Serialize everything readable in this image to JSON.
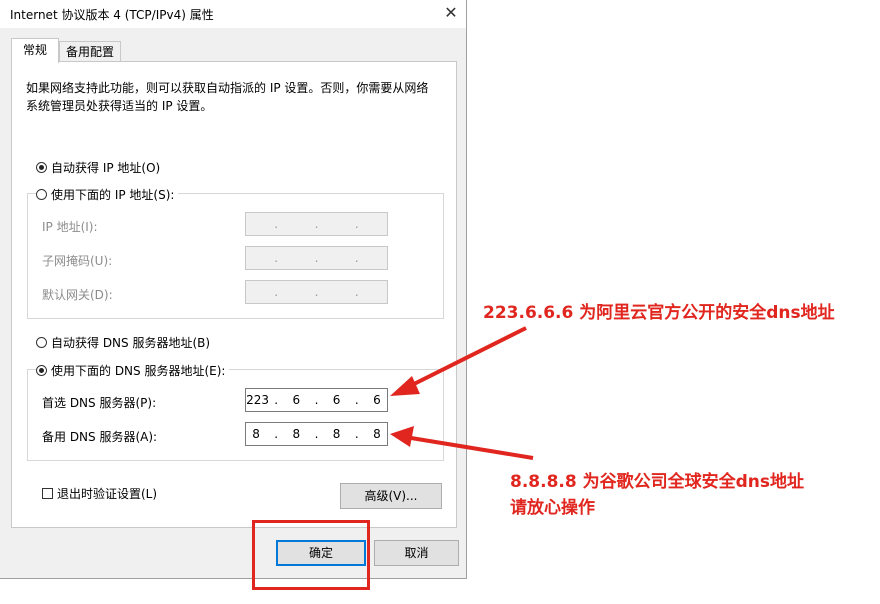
{
  "window": {
    "title": "Internet 协议版本 4 (TCP/IPv4) 属性",
    "close_glyph": "✕"
  },
  "tabs": [
    {
      "label": "常规",
      "active": true
    },
    {
      "label": "备用配置",
      "active": false
    }
  ],
  "description": "如果网络支持此功能，则可以获取自动指派的 IP 设置。否则，你需要从网络系统管理员处获得适当的 IP 设置。",
  "ip_section": {
    "auto_option": {
      "label": "自动获得 IP 地址(O)",
      "selected": true
    },
    "manual_option": {
      "label": "使用下面的 IP 地址(S):",
      "selected": false
    },
    "fields": [
      {
        "label": "IP 地址(I):",
        "octets": [
          "",
          "",
          "",
          ""
        ],
        "enabled": false
      },
      {
        "label": "子网掩码(U):",
        "octets": [
          "",
          "",
          "",
          ""
        ],
        "enabled": false
      },
      {
        "label": "默认网关(D):",
        "octets": [
          "",
          "",
          "",
          ""
        ],
        "enabled": false
      }
    ]
  },
  "dns_section": {
    "auto_option": {
      "label": "自动获得 DNS 服务器地址(B)",
      "selected": false
    },
    "manual_option": {
      "label": "使用下面的 DNS 服务器地址(E):",
      "selected": true
    },
    "fields": [
      {
        "label": "首选 DNS 服务器(P):",
        "octets": [
          "223",
          "6",
          "6",
          "6"
        ],
        "enabled": true
      },
      {
        "label": "备用 DNS 服务器(A):",
        "octets": [
          "8",
          "8",
          "8",
          "8"
        ],
        "enabled": true
      }
    ]
  },
  "validate_checkbox": {
    "label": "退出时验证设置(L)",
    "checked": false
  },
  "buttons": {
    "advanced": "高级(V)...",
    "ok": "确定",
    "cancel": "取消"
  },
  "annotations": {
    "primary_note": "223.6.6.6 为阿里云官方公开的安全dns地址",
    "secondary_note_line1": "8.8.8.8 为谷歌公司全球安全dns地址",
    "secondary_note_line2": "请放心操作",
    "color": "#e0261e"
  }
}
